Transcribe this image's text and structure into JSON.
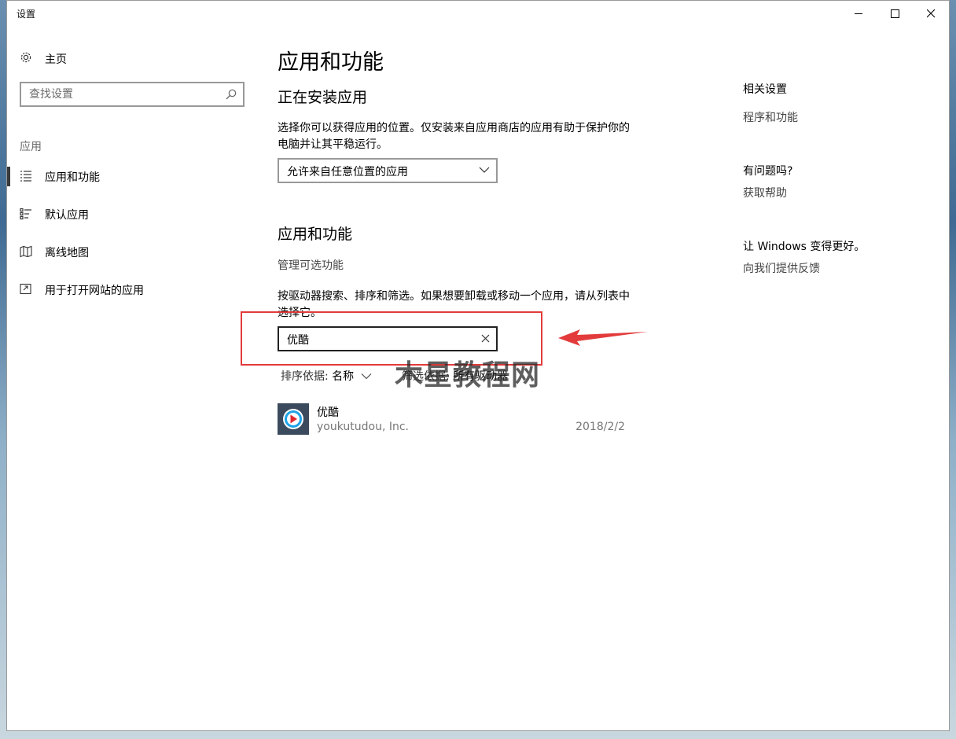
{
  "window": {
    "title": "设置"
  },
  "sidebar": {
    "home_label": "主页",
    "search_placeholder": "查找设置",
    "section_label": "应用",
    "items": [
      {
        "label": "应用和功能",
        "icon": "list-icon",
        "selected": true
      },
      {
        "label": "默认应用",
        "icon": "default-apps-icon",
        "selected": false
      },
      {
        "label": "离线地图",
        "icon": "map-icon",
        "selected": false
      },
      {
        "label": "用于打开网站的应用",
        "icon": "open-web-icon",
        "selected": false
      }
    ]
  },
  "main": {
    "title": "应用和功能",
    "install_heading": "正在安装应用",
    "install_desc": "选择你可以获得应用的位置。仅安装来自应用商店的应用有助于保护你的电脑并让其平稳运行。",
    "install_dropdown_value": "允许来自任意位置的应用",
    "apps_heading": "应用和功能",
    "manage_optional_link": "管理可选功能",
    "apps_desc": "按驱动器搜索、排序和筛选。如果想要卸载或移动一个应用，请从列表中选择它。",
    "filter_value": "优酷",
    "sort_label": "排序依据:",
    "sort_value": "名称",
    "filter_label": "筛选依据:",
    "filter_drive_value": "所有驱动器",
    "apps": [
      {
        "name": "优酷",
        "publisher": "youkutudou, Inc.",
        "date": "2018/2/2"
      }
    ]
  },
  "right": {
    "related_heading": "相关设置",
    "related_link": "程序和功能",
    "question_heading": "有问题吗?",
    "help_link": "获取帮助",
    "feedback_heading": "让 Windows 变得更好。",
    "feedback_link": "向我们提供反馈"
  },
  "overlay": {
    "watermark": "木星教程网",
    "annotation_color": "#e33b3b"
  }
}
